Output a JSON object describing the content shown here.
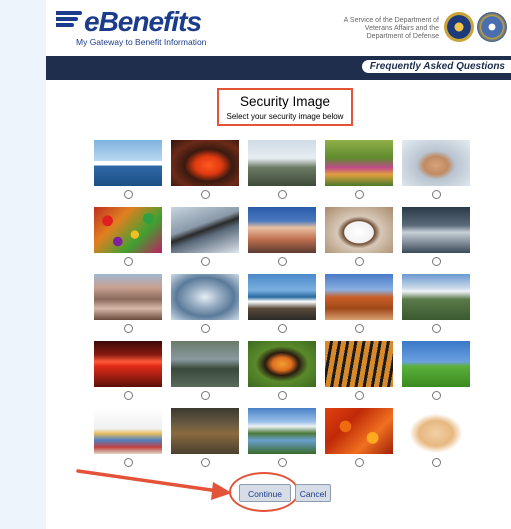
{
  "header": {
    "logo_text": "eBenefits",
    "tagline": "My Gateway to Benefit Information",
    "service_text": "A Service of the Department of Veterans Affairs and the Department of Defense"
  },
  "nav": {
    "faq_label": "Frequently Asked Questions"
  },
  "security": {
    "title": "Security Image",
    "subtitle": "Select your security image below"
  },
  "images": [
    {
      "subject": "sailboats"
    },
    {
      "subject": "red-fish"
    },
    {
      "subject": "helicopter"
    },
    {
      "subject": "garden"
    },
    {
      "subject": "hands"
    },
    {
      "subject": "candies"
    },
    {
      "subject": "bridge"
    },
    {
      "subject": "mountain"
    },
    {
      "subject": "coffee-cup"
    },
    {
      "subject": "jets"
    },
    {
      "subject": "desert-hills"
    },
    {
      "subject": "fighter-jet"
    },
    {
      "subject": "coast"
    },
    {
      "subject": "arch"
    },
    {
      "subject": "valley"
    },
    {
      "subject": "exit-sign"
    },
    {
      "subject": "eagle"
    },
    {
      "subject": "butterfly"
    },
    {
      "subject": "tiger"
    },
    {
      "subject": "cow-field"
    },
    {
      "subject": "abc-blocks"
    },
    {
      "subject": "deer"
    },
    {
      "subject": "river"
    },
    {
      "subject": "autumn-leaves"
    },
    {
      "subject": "kitten"
    }
  ],
  "buttons": {
    "continue_label": "Continue",
    "cancel_label": "Cancel"
  },
  "colors": {
    "nav": "#1f2e4c",
    "brand": "#1b3c8a",
    "annotation": "#e2533a"
  }
}
